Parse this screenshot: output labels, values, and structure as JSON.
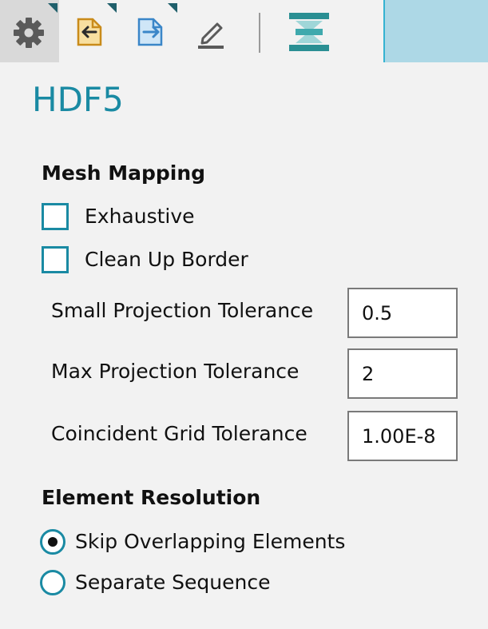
{
  "toolbar": {
    "buttons": [
      {
        "name": "settings",
        "icon": "gear-icon",
        "active": true
      },
      {
        "name": "import",
        "icon": "import-icon"
      },
      {
        "name": "export",
        "icon": "export-icon"
      },
      {
        "name": "edit",
        "icon": "pencil-icon"
      },
      {
        "name": "sequence",
        "icon": "hourglass-icon"
      }
    ],
    "accent_color": "#1a8aa3",
    "highlight_color": "#add8e6"
  },
  "page": {
    "title": "HDF5"
  },
  "mesh_mapping": {
    "heading": "Mesh Mapping",
    "checkboxes": [
      {
        "label": "Exhaustive",
        "checked": false
      },
      {
        "label": "Clean Up Border",
        "checked": false
      }
    ],
    "fields": [
      {
        "label": "Small Projection Tolerance",
        "value": "0.5"
      },
      {
        "label": "Max Projection Tolerance",
        "value": "2"
      },
      {
        "label": "Coincident Grid Tolerance",
        "value": "1.00E-8"
      }
    ]
  },
  "element_resolution": {
    "heading": "Element Resolution",
    "options": [
      {
        "label": "Skip Overlapping Elements",
        "selected": true
      },
      {
        "label": "Separate Sequence",
        "selected": false
      }
    ]
  }
}
